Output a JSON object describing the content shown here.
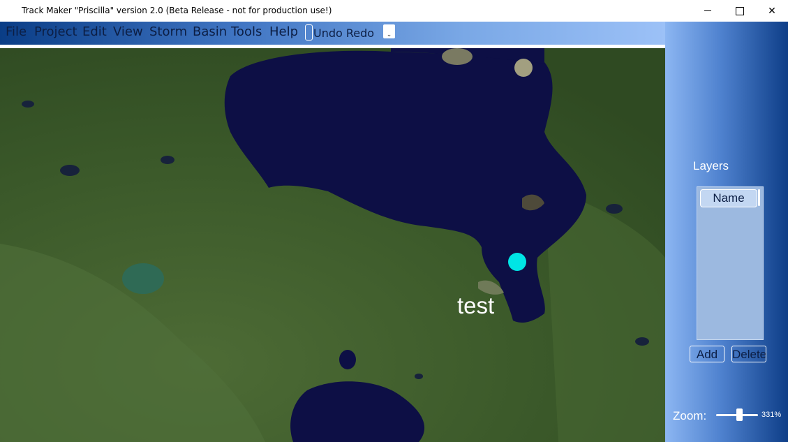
{
  "window": {
    "title": "Track Maker \"Priscilla\" version 2.0 (Beta Release - not for production use!)",
    "close_glyph": "✕"
  },
  "menu": {
    "items": [
      "File",
      "Project",
      "Edit",
      "View",
      "Storm",
      "Basin",
      "Tools",
      "Help"
    ],
    "undo_redo_label": "Undo Redo",
    "dropdown_glyph": "⌄"
  },
  "map": {
    "storm_label": "test",
    "storm_point_color": "#00e5e5"
  },
  "layers": {
    "title": "Layers",
    "column_header": "Name",
    "add_label": "Add",
    "delete_label": "Delete"
  },
  "zoom": {
    "label": "Zoom:",
    "value": "331%"
  },
  "colors": {
    "menubar_dark": "#0a3d86",
    "menubar_light": "#9cc1f7",
    "water": "#0d0f45",
    "land": "#3c5a2a"
  }
}
